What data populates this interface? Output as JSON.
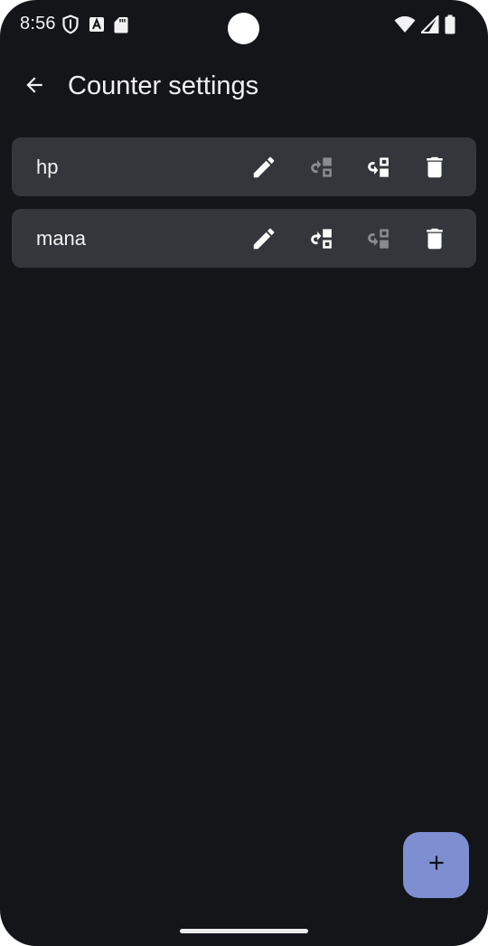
{
  "status_bar": {
    "time": "8:56"
  },
  "app_bar": {
    "title": "Counter settings"
  },
  "counters": [
    {
      "name": "hp",
      "move_up_enabled": false,
      "move_down_enabled": true
    },
    {
      "name": "mana",
      "move_up_enabled": true,
      "move_down_enabled": false
    }
  ],
  "colors": {
    "background": "#141519",
    "row_background": "#35363b",
    "icon_enabled": "#ffffff",
    "icon_disabled": "#8a8b90",
    "fab_background": "#7d8fd1"
  },
  "icons": {
    "back": "arrow-back-icon",
    "edit": "edit-pencil-icon",
    "move_up": "move-up-icon",
    "move_down": "move-down-icon",
    "delete": "delete-trash-icon",
    "add": "plus-icon"
  }
}
